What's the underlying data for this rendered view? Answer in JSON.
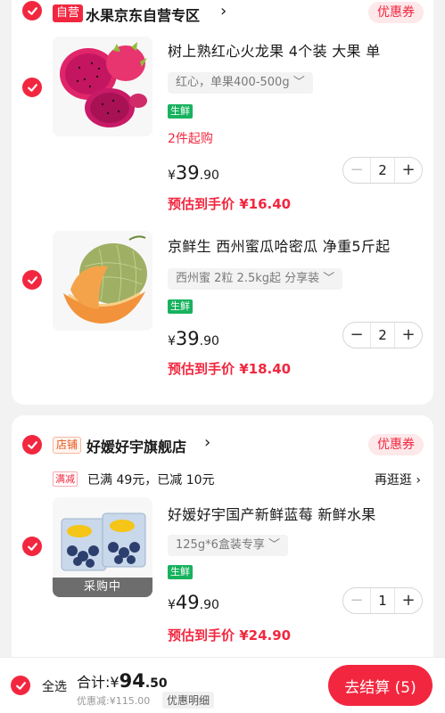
{
  "colors": {
    "accent": "#f2273f",
    "fresh": "#17b25e",
    "background": "#f2f2f2"
  },
  "stores": [
    {
      "badge": "自营",
      "name": "水果京东自营专区",
      "chevron": "›",
      "coupon_label": "优惠券",
      "items": [
        {
          "title": "树上熟红心火龙果 4个装 大果 单",
          "spec": "红心，单果400-500g",
          "tag": "生鲜",
          "min_buy": "2件起购",
          "price_currency": "¥",
          "price_int": "39",
          "price_dec": ".90",
          "est_price": "预估到手价 ¥16.40",
          "qty": "2",
          "minus": "−",
          "plus": "+",
          "image": "dragon-fruit"
        },
        {
          "title": "京鲜生 西州蜜瓜哈密瓜  净重5斤起",
          "spec": "西州蜜 2粒 2.5kg起 分享装",
          "tag": "生鲜",
          "price_currency": "¥",
          "price_int": "39",
          "price_dec": ".90",
          "est_price": "预估到手价 ¥18.40",
          "qty": "2",
          "minus": "−",
          "plus": "+",
          "image": "hami-melon"
        }
      ]
    },
    {
      "badge": "店铺",
      "name": "好媛好宇旗舰店",
      "chevron": "›",
      "coupon_label": "优惠券",
      "promo": {
        "tag": "满减",
        "text": "已满 49元，已减 10元",
        "link": "再逛逛 ›"
      },
      "items": [
        {
          "title": "好媛好宇国产新鲜蓝莓 新鲜水果",
          "spec": "125g*6盒装专享",
          "tag": "生鲜",
          "overlay": "采购中",
          "price_currency": "¥",
          "price_int": "49",
          "price_dec": ".90",
          "est_price": "预估到手价 ¥24.90",
          "qty": "1",
          "minus": "−",
          "plus": "+",
          "image": "blueberries"
        }
      ]
    }
  ],
  "footer": {
    "select_all": "全选",
    "total_prefix": "合计:¥",
    "total_int": "94",
    "total_dec": ".50",
    "discount": "优惠减:¥115.00",
    "detail": "优惠明细",
    "checkout": "去结算 (5)"
  }
}
